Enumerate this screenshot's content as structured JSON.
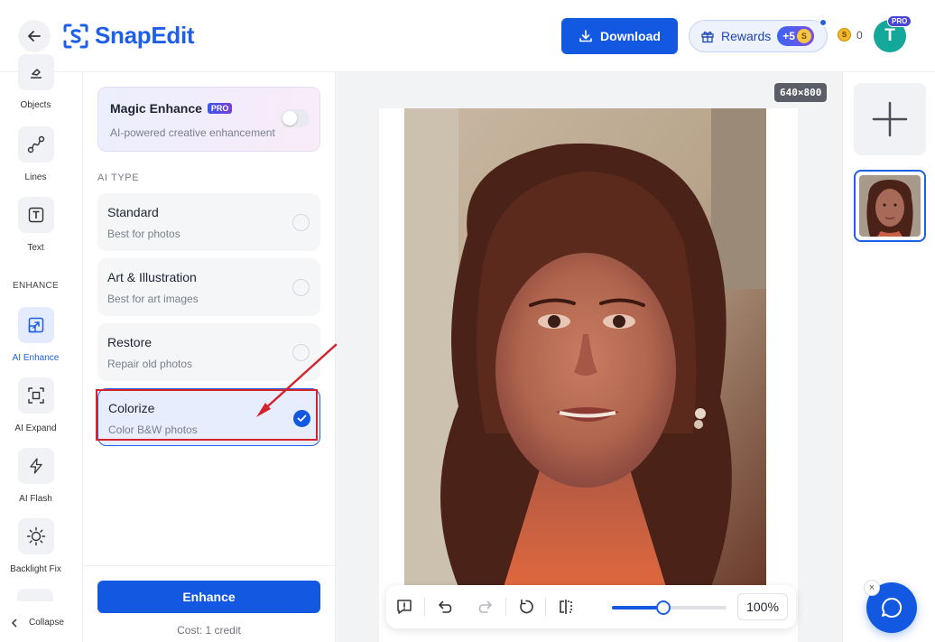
{
  "header": {
    "logo_text": "SnapEdit",
    "download_label": "Download",
    "rewards_label": "Rewards",
    "rewards_bonus": "+5",
    "coin_count": "0",
    "avatar_initial": "T",
    "pro_tag": "PRO"
  },
  "tools": {
    "items": [
      {
        "label": "Objects",
        "icon": "eraser-icon"
      },
      {
        "label": "Lines",
        "icon": "line-icon"
      },
      {
        "label": "Text",
        "icon": "text-icon"
      },
      {
        "label": "AI Enhance",
        "icon": "enhance-icon",
        "active": true
      },
      {
        "label": "AI Expand",
        "icon": "expand-icon"
      },
      {
        "label": "AI Flash",
        "icon": "flash-icon"
      },
      {
        "label": "Backlight Fix",
        "icon": "sun-icon"
      }
    ],
    "section_enhance": "ENHANCE",
    "collapse_label": "Collapse"
  },
  "panel": {
    "magic_title": "Magic Enhance",
    "magic_pro": "PRO",
    "magic_sub": "AI-powered creative enhancement",
    "magic_enabled": false,
    "ai_type_label": "AI TYPE",
    "options": [
      {
        "title": "Standard",
        "sub": "Best for photos",
        "selected": false
      },
      {
        "title": "Art & Illustration",
        "sub": "Best for art images",
        "selected": false
      },
      {
        "title": "Restore",
        "sub": "Repair old photos",
        "selected": false
      },
      {
        "title": "Colorize",
        "sub": "Color B&W photos",
        "selected": true
      }
    ],
    "enhance_label": "Enhance",
    "cost_label": "Cost: 1 credit"
  },
  "canvas": {
    "size_badge": "640×800",
    "zoom_value": "100%",
    "zoom_level": 0.45
  },
  "colors": {
    "accent": "#1258e0",
    "annotation": "#d4232d"
  }
}
